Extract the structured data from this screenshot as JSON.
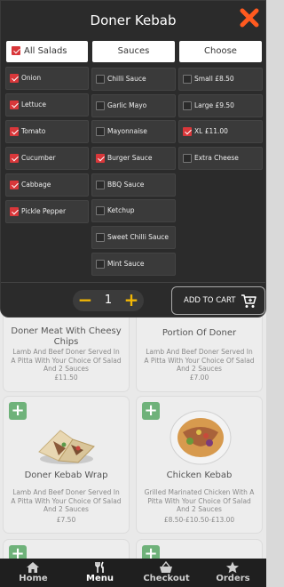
{
  "modal": {
    "title": "Doner Kebab",
    "columns": {
      "salads": {
        "header": "All Salads",
        "header_checked": true,
        "items": [
          {
            "label": "Onion",
            "checked": true
          },
          {
            "label": "Lettuce",
            "checked": true
          },
          {
            "label": "Tomato",
            "checked": true
          },
          {
            "label": "Cucumber",
            "checked": true
          },
          {
            "label": "Cabbage",
            "checked": true
          },
          {
            "label": "Pickle Pepper",
            "checked": true
          }
        ]
      },
      "sauces": {
        "header": "Sauces",
        "items": [
          {
            "label": "Chilli Sauce",
            "checked": false
          },
          {
            "label": "Garlic Mayo",
            "checked": false
          },
          {
            "label": "Mayonnaise",
            "checked": false
          },
          {
            "label": "Burger Sauce",
            "checked": true
          },
          {
            "label": "BBQ Sauce",
            "checked": false
          },
          {
            "label": "Ketchup",
            "checked": false
          },
          {
            "label": "Sweet Chilli Sauce",
            "checked": false
          },
          {
            "label": "Mint Sauce",
            "checked": false
          }
        ]
      },
      "choose": {
        "header": "Choose",
        "items": [
          {
            "label": "Small £8.50",
            "checked": false
          },
          {
            "label": "Large £9.50",
            "checked": false
          },
          {
            "label": "XL £11.00",
            "checked": true
          },
          {
            "label": "Extra Cheese",
            "checked": false
          }
        ]
      }
    },
    "quantity": "1",
    "minus_symbol": "−",
    "plus_symbol": "+",
    "add_to_cart_label": "ADD TO CART"
  },
  "menu_items": [
    {
      "title": "Doner Meat With Cheesy Chips",
      "desc": "Lamb And Beef Doner Served In A Pitta With Your Choice Of Salad And 2 Sauces",
      "price": "£11.50"
    },
    {
      "title": "Portion Of Doner",
      "desc": "Lamb And Beef Doner Served In A Pitta With Your Choice Of Salad And 2 Sauces",
      "price": "£7.00"
    },
    {
      "title": "Doner Kebab Wrap",
      "desc": "Lamb And Beef Doner Served In A Pitta With Your Choice Of Salad And 2 Sauces",
      "price": "£7.50"
    },
    {
      "title": "Chicken Kebab",
      "desc": "Grilled Marinated Chicken With A Pitta With Your Choice Of Salad And 2 Sauces",
      "price": "£8.50-£10.50-£13.00"
    }
  ],
  "add_symbol": "+",
  "bottom_nav": [
    {
      "label": "Home",
      "icon": "home-icon",
      "active": false
    },
    {
      "label": "Menu",
      "icon": "cutlery-icon",
      "active": true
    },
    {
      "label": "Checkout",
      "icon": "basket-icon",
      "active": false
    },
    {
      "label": "Orders",
      "icon": "star-icon",
      "active": false
    }
  ],
  "colors": {
    "accent": "#f2b705",
    "close": "#ff5a1f",
    "checkbox": "#d9373a",
    "add": "#6fb27a"
  }
}
